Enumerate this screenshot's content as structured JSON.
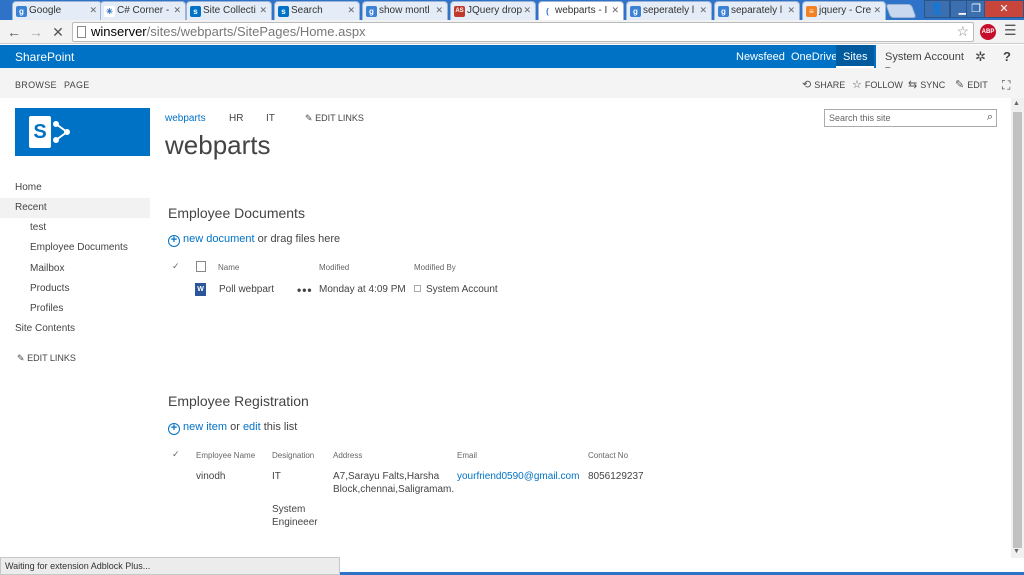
{
  "browser": {
    "tabs": [
      {
        "label": "Google",
        "fav": "g"
      },
      {
        "label": "C# Corner -",
        "fav": "c"
      },
      {
        "label": "Site Collecti",
        "fav": "s"
      },
      {
        "label": "Search",
        "fav": "s"
      },
      {
        "label": "show montl",
        "fav": "g"
      },
      {
        "label": "JQuery drop",
        "fav": "as"
      },
      {
        "label": "webparts - I",
        "fav": "loading"
      },
      {
        "label": "seperately l",
        "fav": "g"
      },
      {
        "label": "separately l",
        "fav": "g"
      },
      {
        "label": "jquery - Cre",
        "fav": "so"
      }
    ],
    "url_host": "winserver",
    "url_path": "/sites/webparts/SitePages/Home.aspx",
    "status_text": "Waiting for extension Adblock Plus...",
    "adblock_label": "ABP"
  },
  "suitebar": {
    "brand": "SharePoint",
    "newsfeed": "Newsfeed",
    "onedrive": "OneDrive",
    "sites": "Sites",
    "user": "System Account ▾"
  },
  "ribbon": {
    "browse": "BROWSE",
    "page": "PAGE",
    "share": "SHARE",
    "follow": "FOLLOW",
    "sync": "SYNC",
    "edit": "EDIT"
  },
  "topnav": {
    "links": [
      "webparts",
      "HR",
      "IT"
    ],
    "edit_links": "EDIT LINKS"
  },
  "site": {
    "title": "webparts",
    "search_placeholder": "Search this site"
  },
  "quicklaunch": {
    "home": "Home",
    "recent": "Recent",
    "recent_items": [
      "test",
      "Employee Documents",
      "Mailbox",
      "Products",
      "Profiles"
    ],
    "site_contents": "Site Contents",
    "edit_links": "EDIT LINKS"
  },
  "documents": {
    "title": "Employee Documents",
    "new_link": "new document",
    "new_suffix": " or drag files here",
    "headers": {
      "name": "Name",
      "modified": "Modified",
      "modified_by": "Modified By"
    },
    "rows": [
      {
        "name": "Poll webpart",
        "modified": "Monday at 4:09 PM",
        "modified_by": "System Account"
      }
    ]
  },
  "registration": {
    "title": "Employee Registration",
    "new_link": "new item",
    "or_text": " or ",
    "edit_link": "edit",
    "suffix": " this list",
    "headers": {
      "name": "Employee Name",
      "designation": "Designation",
      "address": "Address",
      "email": "Email",
      "contact": "Contact No"
    },
    "rows": [
      {
        "name": "vinodh",
        "designation": "IT",
        "address_line1": "A7,Sarayu Falts,Harsha",
        "address_line2": "Block,chennai,Saligramam.",
        "email": "yourfriend0590@gmail.com",
        "contact": "8056129237",
        "extra_line1": "System",
        "extra_line2": "Engineeer"
      }
    ]
  }
}
